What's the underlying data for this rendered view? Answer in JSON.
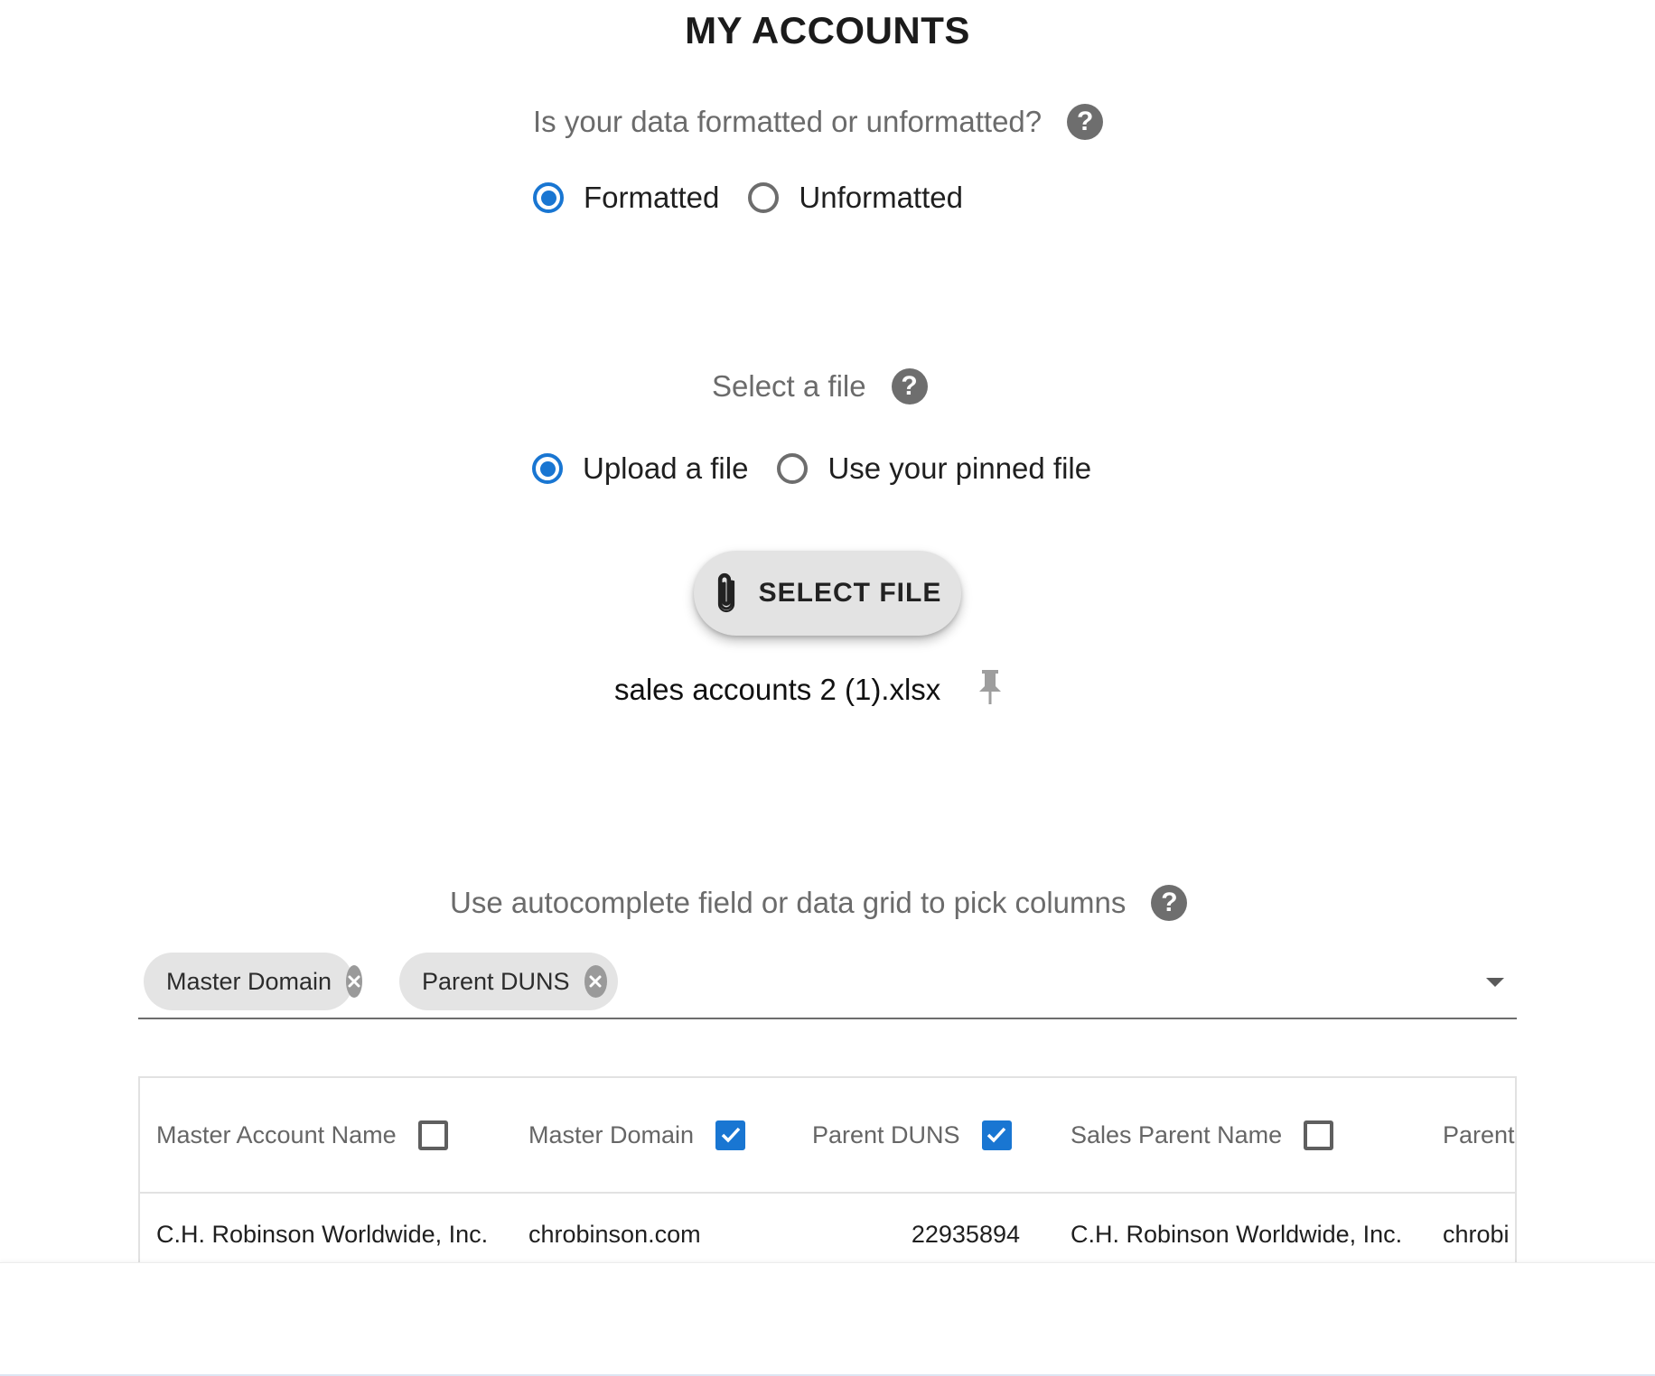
{
  "page": {
    "title": "MY ACCOUNTS"
  },
  "format_section": {
    "question": "Is your data formatted or unformatted?",
    "options": [
      {
        "label": "Formatted",
        "selected": true
      },
      {
        "label": "Unformatted",
        "selected": false
      }
    ]
  },
  "file_section": {
    "question": "Select a file",
    "options": [
      {
        "label": "Upload a file",
        "selected": true
      },
      {
        "label": "Use your pinned file",
        "selected": false
      }
    ],
    "select_button_label": "SELECT FILE",
    "filename": "sales accounts 2 (1).xlsx"
  },
  "columns_section": {
    "question": "Use autocomplete field or data grid to pick columns",
    "chips": [
      "Master Domain",
      "Parent DUNS"
    ]
  },
  "grid": {
    "columns": [
      {
        "label": "Master Account Name",
        "checked": false
      },
      {
        "label": "Master Domain",
        "checked": true
      },
      {
        "label": "Parent DUNS",
        "checked": true
      },
      {
        "label": "Sales Parent Name",
        "checked": false
      },
      {
        "label": "Parent",
        "checked": false
      }
    ],
    "rows": [
      [
        "C.H. Robinson Worldwide, Inc.",
        "chrobinson.com",
        "22935894",
        "C.H. Robinson Worldwide, Inc.",
        "chrobi"
      ]
    ]
  },
  "colors": {
    "accent": "#1976d2",
    "help_icon": "#6e6e6e",
    "chip_bg": "#e4e4e4"
  },
  "icons": {
    "help": "question-mark-circle",
    "attach": "paperclip",
    "pin": "pushpin",
    "chip_delete": "x-circle",
    "dropdown": "caret-down",
    "checkbox_checked": "check"
  }
}
